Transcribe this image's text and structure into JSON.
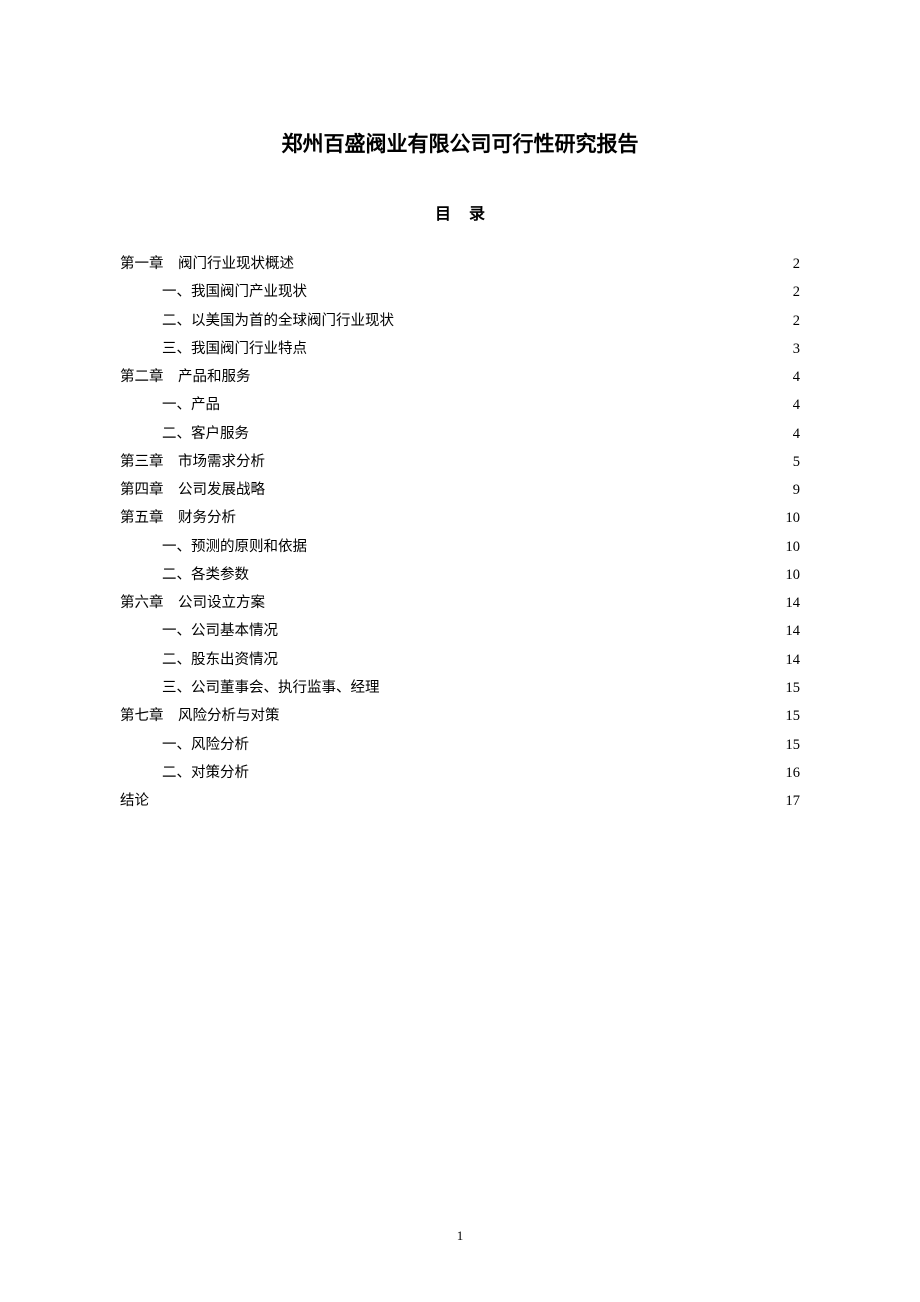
{
  "title": "郑州百盛阀业有限公司可行性研究报告",
  "tocHeading": "目录",
  "pageNumber": "1",
  "toc": [
    {
      "level": 0,
      "label": "第一章",
      "text": "阀门行业现状概述",
      "page": "2"
    },
    {
      "level": 1,
      "label": "一、",
      "text": "我国阀门产业现状",
      "page": "2"
    },
    {
      "level": 1,
      "label": "二、",
      "text": "以美国为首的全球阀门行业现状",
      "page": "2"
    },
    {
      "level": 1,
      "label": "三、",
      "text": "我国阀门行业特点",
      "page": "3"
    },
    {
      "level": 0,
      "label": "第二章",
      "text": "产品和服务",
      "page": "4"
    },
    {
      "level": 1,
      "label": "一、",
      "text": "产品",
      "page": "4"
    },
    {
      "level": 1,
      "label": "二、",
      "text": "客户服务",
      "page": "4"
    },
    {
      "level": 0,
      "label": "第三章",
      "text": "市场需求分析",
      "page": "5"
    },
    {
      "level": 0,
      "label": "第四章",
      "text": "公司发展战略",
      "page": "9"
    },
    {
      "level": 0,
      "label": "第五章",
      "text": "财务分析",
      "page": "10"
    },
    {
      "level": 1,
      "label": "一、",
      "text": "预测的原则和依据",
      "page": "10"
    },
    {
      "level": 1,
      "label": "二、",
      "text": "各类参数",
      "page": "10"
    },
    {
      "level": 0,
      "label": "第六章",
      "text": "公司设立方案",
      "page": "14"
    },
    {
      "level": 1,
      "label": "一、",
      "text": "公司基本情况",
      "page": "14"
    },
    {
      "level": 1,
      "label": "二、",
      "text": "股东出资情况",
      "page": "14"
    },
    {
      "level": 1,
      "label": "三、",
      "text": "公司董事会、执行监事、经理",
      "page": "15"
    },
    {
      "level": 0,
      "label": "第七章",
      "text": "风险分析与对策",
      "page": "15"
    },
    {
      "level": 1,
      "label": "一、",
      "text": "风险分析",
      "page": "15"
    },
    {
      "level": 1,
      "label": "二、",
      "text": "对策分析",
      "page": "16"
    },
    {
      "level": 0,
      "label": "",
      "text": "结论",
      "page": "17"
    }
  ]
}
